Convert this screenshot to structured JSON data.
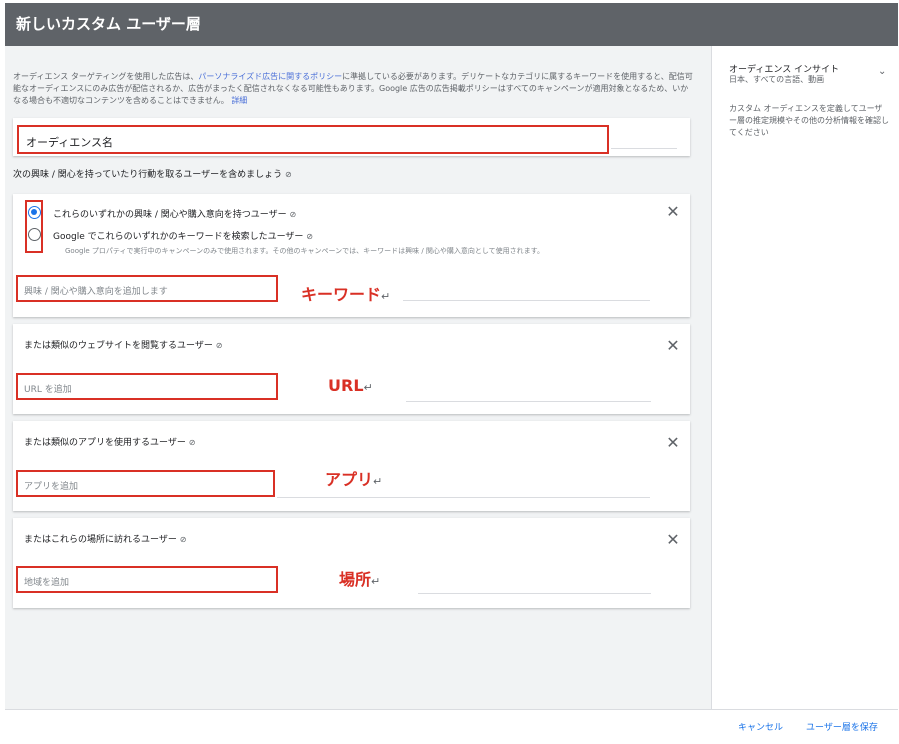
{
  "dialog": {
    "title": "新しいカスタム ユーザー層"
  },
  "policy": {
    "text_before": "オーディエンス ターゲティングを使用した広告は、",
    "policy_link": "パーソナライズド広告に関するポリシー",
    "text_after": "に準拠している必要があります。デリケートなカテゴリに属するキーワードを使用すると、配信可能なオーディエンスにのみ広告が配信されるか、広告がまったく配信されなくなる可能性もあります。Google 広告の広告掲載ポリシーはすべてのキャンペーンが適用対象となるため、いかなる場合も不適切なコンテンツを含めることはできません。",
    "detail_link": "詳細"
  },
  "audience_name": {
    "placeholder": "オーディエンス名"
  },
  "interest_section": {
    "label": "次の興味 / 関心を持っていたり行動を取るユーザーを含めましょう"
  },
  "keywords_card": {
    "option1": "これらのいずれかの興味 / 関心や購入意向を持つユーザー",
    "option2": "Google でこれらのいずれかのキーワードを検索したユーザー",
    "option2_note": "Google プロパティで実行中のキャンペーンのみで使用されます。その他のキャンペーンでは、キーワードは興味 / 関心や購入意向として使用されます。",
    "selected_option": 1,
    "input_placeholder": "興味 / 関心や購入意向を追加します",
    "annotation": "キーワード"
  },
  "url_card": {
    "title": "または類似のウェブサイトを閲覧するユーザー",
    "input_placeholder": "URL を追加",
    "annotation": "URL"
  },
  "app_card": {
    "title": "または類似のアプリを使用するユーザー",
    "input_placeholder": "アプリを追加",
    "annotation": "アプリ"
  },
  "location_card": {
    "title": "またはこれらの場所に訪れるユーザー",
    "input_placeholder": "地域を追加",
    "annotation": "場所"
  },
  "sidebar": {
    "insight_title": "オーディエンス インサイト",
    "insight_sub": "日本、すべての言語、動画",
    "description": "カスタム オーディエンスを定義してユーザー層の推定規模やその他の分析情報を確認してください"
  },
  "footer": {
    "cancel": "キャンセル",
    "save": "ユーザー層を保存"
  },
  "icons": {
    "help": "help-circle-icon",
    "close": "close-icon",
    "chevron": "chevron-down-icon",
    "return_mark": "return-arrow-icon"
  },
  "glyphs": {
    "help": "⊘",
    "close": "✕",
    "chevron": "⌄",
    "return_mark": "↵"
  },
  "colors": {
    "header": "#5f6368",
    "accent": "#1a73e8",
    "annotation_red": "#d93025",
    "link": "#4a6fd8"
  }
}
